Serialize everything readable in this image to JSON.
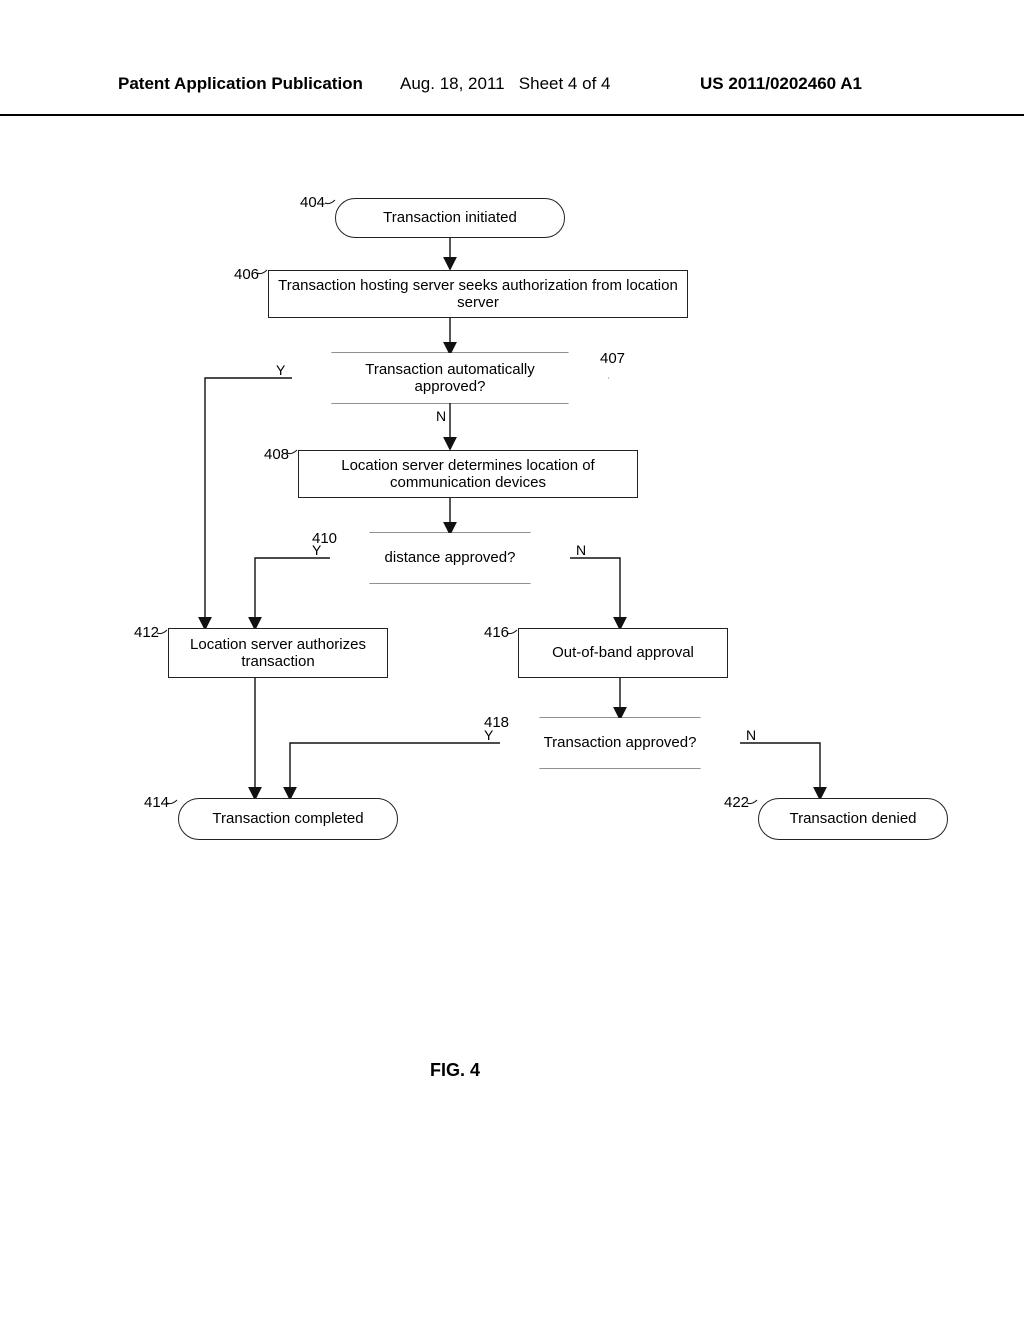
{
  "header": {
    "left": "Patent Application Publication",
    "date": "Aug. 18, 2011",
    "sheet": "Sheet 4 of 4",
    "pubno": "US 2011/0202460 A1"
  },
  "refs": {
    "r404": "404",
    "r406": "406",
    "r407": "407",
    "r408": "408",
    "r410": "410",
    "r412": "412",
    "r414": "414",
    "r416": "416",
    "r418": "418",
    "r422": "422"
  },
  "nodes": {
    "n404": "Transaction initiated",
    "n406": "Transaction hosting server seeks authorization from location server",
    "n407": "Transaction automatically approved?",
    "n408": "Location server determines location of communication devices",
    "n410": "distance approved?",
    "n412": "Location server authorizes transaction",
    "n414": "Transaction completed",
    "n416": "Out-of-band approval",
    "n418": "Transaction approved?",
    "n422": "Transaction denied"
  },
  "labels": {
    "Y": "Y",
    "N": "N"
  },
  "figure_caption": "FIG. 4"
}
